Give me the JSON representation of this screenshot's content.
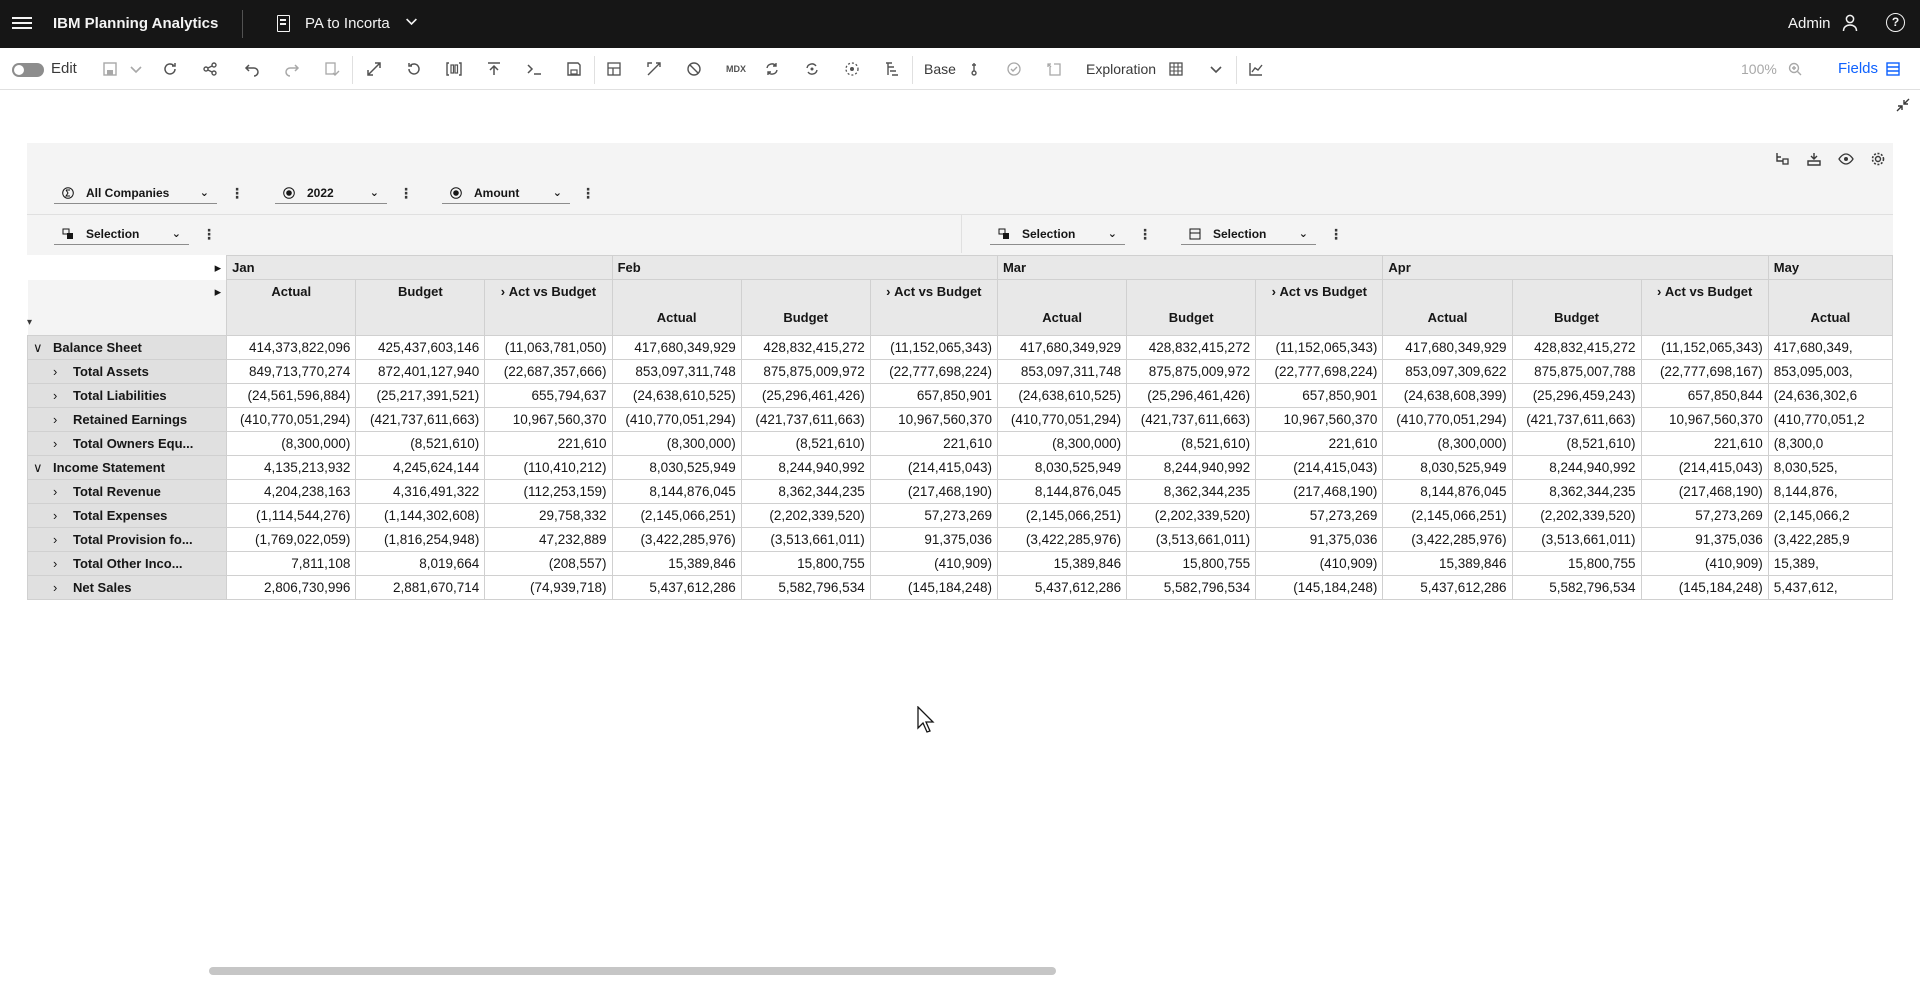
{
  "header": {
    "brand": "IBM Planning Analytics",
    "workbench": "PA to Incorta",
    "user": "Admin"
  },
  "toolbar": {
    "edit_label": "Edit",
    "base_label": "Base",
    "exploration_label": "Exploration",
    "zoom": "100%",
    "fields_label": "Fields",
    "mdx_label": "MDX"
  },
  "context": {
    "company": "All Companies",
    "year": "2022",
    "measure": "Amount",
    "selection_row": "Selection",
    "selection_col1": "Selection",
    "selection_col2": "Selection"
  },
  "grid": {
    "months": [
      "Jan",
      "Feb",
      "Mar",
      "Apr",
      "May"
    ],
    "col_labels": [
      "Actual",
      "Budget",
      "Act vs Budget"
    ],
    "rows": [
      {
        "label": "Balance Sheet",
        "level": 0,
        "expanded": true,
        "values": [
          "414,373,822,096",
          "425,437,603,146",
          "(11,063,781,050)",
          "417,680,349,929",
          "428,832,415,272",
          "(11,152,065,343)",
          "417,680,349,929",
          "428,832,415,272",
          "(11,152,065,343)",
          "417,680,349,929",
          "428,832,415,272",
          "(11,152,065,343)",
          "417,680,349,"
        ]
      },
      {
        "label": "Total Assets",
        "level": 1,
        "expanded": false,
        "values": [
          "849,713,770,274",
          "872,401,127,940",
          "(22,687,357,666)",
          "853,097,311,748",
          "875,875,009,972",
          "(22,777,698,224)",
          "853,097,311,748",
          "875,875,009,972",
          "(22,777,698,224)",
          "853,097,309,622",
          "875,875,007,788",
          "(22,777,698,167)",
          "853,095,003,"
        ]
      },
      {
        "label": "Total Liabilities",
        "level": 1,
        "expanded": false,
        "values": [
          "(24,561,596,884)",
          "(25,217,391,521)",
          "655,794,637",
          "(24,638,610,525)",
          "(25,296,461,426)",
          "657,850,901",
          "(24,638,610,525)",
          "(25,296,461,426)",
          "657,850,901",
          "(24,638,608,399)",
          "(25,296,459,243)",
          "657,850,844",
          "(24,636,302,6"
        ]
      },
      {
        "label": "Retained Earnings",
        "level": 1,
        "expanded": false,
        "values": [
          "(410,770,051,294)",
          "(421,737,611,663)",
          "10,967,560,370",
          "(410,770,051,294)",
          "(421,737,611,663)",
          "10,967,560,370",
          "(410,770,051,294)",
          "(421,737,611,663)",
          "10,967,560,370",
          "(410,770,051,294)",
          "(421,737,611,663)",
          "10,967,560,370",
          "(410,770,051,2"
        ]
      },
      {
        "label": "Total Owners Equ...",
        "level": 1,
        "expanded": false,
        "values": [
          "(8,300,000)",
          "(8,521,610)",
          "221,610",
          "(8,300,000)",
          "(8,521,610)",
          "221,610",
          "(8,300,000)",
          "(8,521,610)",
          "221,610",
          "(8,300,000)",
          "(8,521,610)",
          "221,610",
          "(8,300,0"
        ]
      },
      {
        "label": "Income Statement",
        "level": 0,
        "expanded": true,
        "values": [
          "4,135,213,932",
          "4,245,624,144",
          "(110,410,212)",
          "8,030,525,949",
          "8,244,940,992",
          "(214,415,043)",
          "8,030,525,949",
          "8,244,940,992",
          "(214,415,043)",
          "8,030,525,949",
          "8,244,940,992",
          "(214,415,043)",
          "8,030,525,"
        ]
      },
      {
        "label": "Total  Revenue",
        "level": 1,
        "expanded": false,
        "values": [
          "4,204,238,163",
          "4,316,491,322",
          "(112,253,159)",
          "8,144,876,045",
          "8,362,344,235",
          "(217,468,190)",
          "8,144,876,045",
          "8,362,344,235",
          "(217,468,190)",
          "8,144,876,045",
          "8,362,344,235",
          "(217,468,190)",
          "8,144,876,"
        ]
      },
      {
        "label": "Total Expenses",
        "level": 1,
        "expanded": false,
        "values": [
          "(1,114,544,276)",
          "(1,144,302,608)",
          "29,758,332",
          "(2,145,066,251)",
          "(2,202,339,520)",
          "57,273,269",
          "(2,145,066,251)",
          "(2,202,339,520)",
          "57,273,269",
          "(2,145,066,251)",
          "(2,202,339,520)",
          "57,273,269",
          "(2,145,066,2"
        ]
      },
      {
        "label": "Total Provision fo...",
        "level": 1,
        "expanded": false,
        "values": [
          "(1,769,022,059)",
          "(1,816,254,948)",
          "47,232,889",
          "(3,422,285,976)",
          "(3,513,661,011)",
          "91,375,036",
          "(3,422,285,976)",
          "(3,513,661,011)",
          "91,375,036",
          "(3,422,285,976)",
          "(3,513,661,011)",
          "91,375,036",
          "(3,422,285,9"
        ]
      },
      {
        "label": "Total Other Inco...",
        "level": 1,
        "expanded": false,
        "values": [
          "7,811,108",
          "8,019,664",
          "(208,557)",
          "15,389,846",
          "15,800,755",
          "(410,909)",
          "15,389,846",
          "15,800,755",
          "(410,909)",
          "15,389,846",
          "15,800,755",
          "(410,909)",
          "15,389,"
        ]
      },
      {
        "label": "Net Sales",
        "level": 1,
        "expanded": false,
        "values": [
          "2,806,730,996",
          "2,881,670,714",
          "(74,939,718)",
          "5,437,612,286",
          "5,582,796,534",
          "(145,184,248)",
          "5,437,612,286",
          "5,582,796,534",
          "(145,184,248)",
          "5,437,612,286",
          "5,582,796,534",
          "(145,184,248)",
          "5,437,612,"
        ]
      }
    ]
  }
}
